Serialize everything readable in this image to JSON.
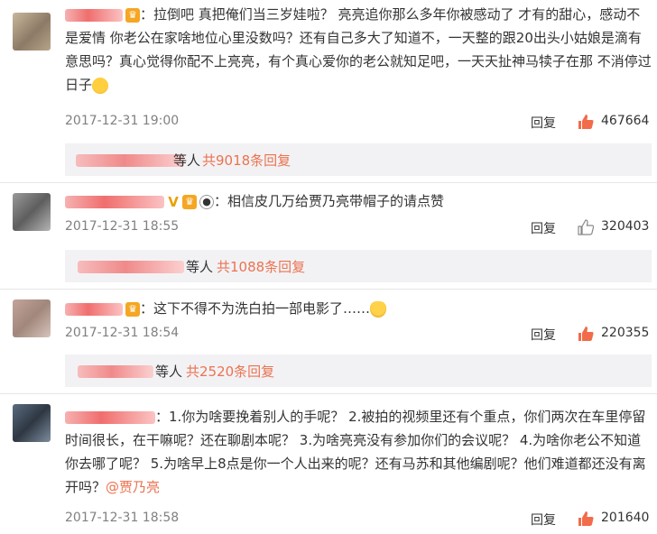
{
  "comments": [
    {
      "text": "：拉倒吧 真把俺们当三岁娃啦？ 亮亮追你那么多年你被感动了 才有的甜心，感动不是爱情 你老公在家啥地位心里没数吗？还有自己多大了知道不，一天整的跟20出头小姑娘是滴有意思吗？真心觉得你配不上亮亮，有个真心爱你的老公就知足吧，一天天扯神马犊子在那 不消停过日子",
      "time": "2017-12-31 19:00",
      "reply_label": "回复",
      "likes": "467664",
      "thumb_style": "filled",
      "sub": {
        "deng": "等人",
        "total": "共9018条回复"
      }
    },
    {
      "text": "：相信皮几万给贾乃亮带帽子的请点赞",
      "time": "2017-12-31 18:55",
      "reply_label": "回复",
      "likes": "320403",
      "thumb_style": "outline",
      "sub": {
        "deng": "等人",
        "total": "共1088条回复"
      }
    },
    {
      "text": "：这下不得不为洗白拍一部电影了……",
      "time": "2017-12-31 18:54",
      "reply_label": "回复",
      "likes": "220355",
      "thumb_style": "filled",
      "sub": {
        "deng": "等人",
        "total": "共2520条回复"
      }
    },
    {
      "text": "：1.你为啥要挽着别人的手呢？ 2.被拍的视频里还有个重点，你们两次在车里停留时间很长，在干嘛呢？还在聊剧本呢？ 3.为啥亮亮没有参加你们的会议呢？ 4.为啥你老公不知道你去哪了呢？ 5.为啥早上8点是你一个人出来的呢？还有马苏和其他编剧呢？他们难道都还没有离开吗？",
      "mention": "@贾乃亮",
      "time": "2017-12-31 18:58",
      "reply_label": "回复",
      "likes": "201640",
      "thumb_style": "filled"
    }
  ],
  "colors": {
    "accent": "#eb7350",
    "thumb": "#f26b4a",
    "meta": "#808080",
    "subbox_bg": "#f2f2f5"
  },
  "icons": [
    "thumbs-up-icon",
    "laughing-emoji-icon",
    "vip-crown-icon",
    "verified-v-icon",
    "panda-icon",
    "man-emoji-icon"
  ]
}
